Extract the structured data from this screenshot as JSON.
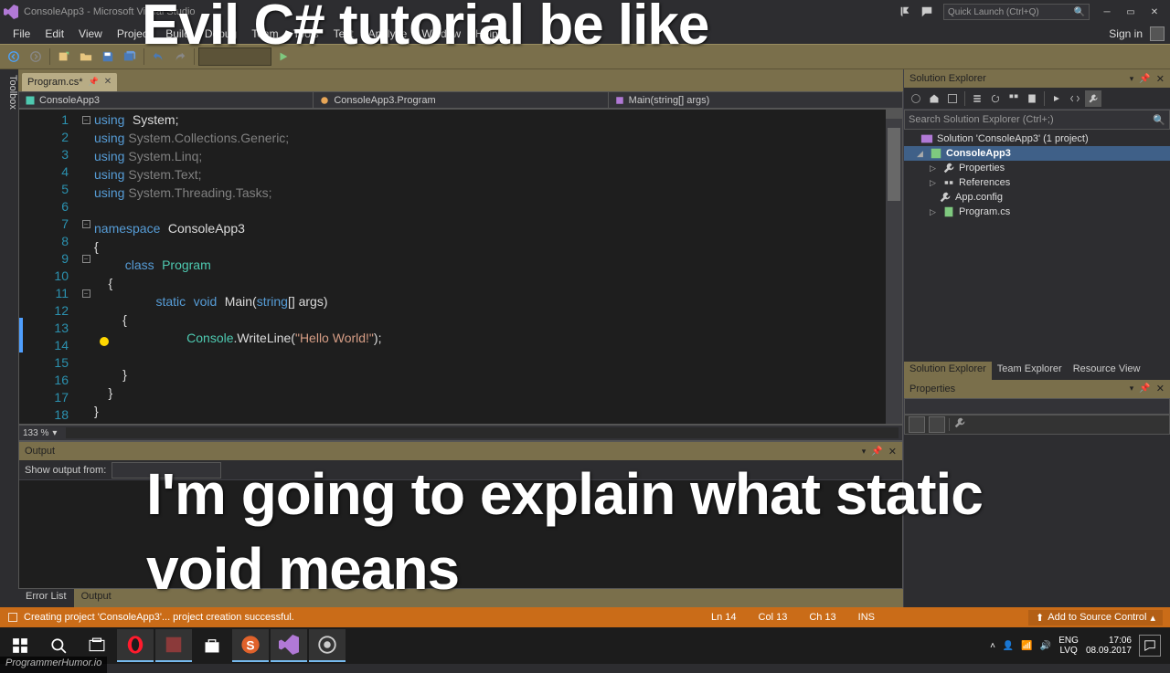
{
  "title": "ConsoleApp3 - Microsoft Visual Studio",
  "quick_launch_placeholder": "Quick Launch (Ctrl+Q)",
  "menu": {
    "items": [
      "File",
      "Edit",
      "View",
      "Project",
      "Build",
      "Debug",
      "Team",
      "Tools",
      "Test",
      "Analyze",
      "Window",
      "Help"
    ],
    "signin": "Sign in"
  },
  "toolbox_label": "Toolbox",
  "file_tab": {
    "name": "Program.cs*",
    "dirty": true
  },
  "nav": {
    "project": "ConsoleApp3",
    "class": "ConsoleApp3.Program",
    "member": "Main(string[] args)"
  },
  "code": {
    "lines": [
      1,
      2,
      3,
      4,
      5,
      6,
      7,
      8,
      9,
      10,
      11,
      12,
      13,
      14,
      15,
      16,
      17,
      18
    ],
    "l1": {
      "kw": "using",
      "ns": "System",
      "end": ";"
    },
    "l2": {
      "kw": "using",
      "ns": "System.Collections.Generic;"
    },
    "l3": {
      "kw": "using",
      "ns": "System.Linq;"
    },
    "l4": {
      "kw": "using",
      "ns": "System.Text;"
    },
    "l5": {
      "kw": "using",
      "ns": "System.Threading.Tasks;"
    },
    "l7a": "namespace",
    "l7b": "ConsoleApp3",
    "l8": "{",
    "l9a": "class",
    "l9b": "Program",
    "l10": "    {",
    "l11a": "static",
    "l11b": "void",
    "l11c": "Main(",
    "l11d": "string",
    "l11e": "[] args)",
    "l12": "        {",
    "l13a": "Console",
    "l13b": ".WriteLine(",
    "l13c": "\"Hello World!\"",
    "l13d": ");",
    "l14": "            ",
    "l15": "        }",
    "l16": "    }",
    "l17": "}"
  },
  "zoom": "133 %",
  "output": {
    "title": "Output",
    "show_from": "Show output from:"
  },
  "bottom_tabs": {
    "error": "Error List",
    "output": "Output"
  },
  "solution_explorer": {
    "title": "Solution Explorer",
    "search_placeholder": "Search Solution Explorer (Ctrl+;)",
    "root": "Solution 'ConsoleApp3' (1 project)",
    "project": "ConsoleApp3",
    "nodes": [
      "Properties",
      "References",
      "App.config",
      "Program.cs"
    ]
  },
  "sln_tabs": {
    "se": "Solution Explorer",
    "te": "Team Explorer",
    "rv": "Resource View"
  },
  "properties": {
    "title": "Properties"
  },
  "status": {
    "msg": "Creating project 'ConsoleApp3'... project creation successful.",
    "ln": "Ln 14",
    "col": "Col 13",
    "ch": "Ch 13",
    "mode": "INS",
    "addsrc": "Add to Source Control"
  },
  "taskbar": {
    "lang": "ENG",
    "kb": "LVQ",
    "time": "17:06",
    "date": "08.09.2017"
  },
  "watermark": "ProgrammerHumor.io",
  "meme": {
    "top": "Evil C# tutorial be like",
    "bottom1": "I'm going to explain what static",
    "bottom2": "void means"
  }
}
